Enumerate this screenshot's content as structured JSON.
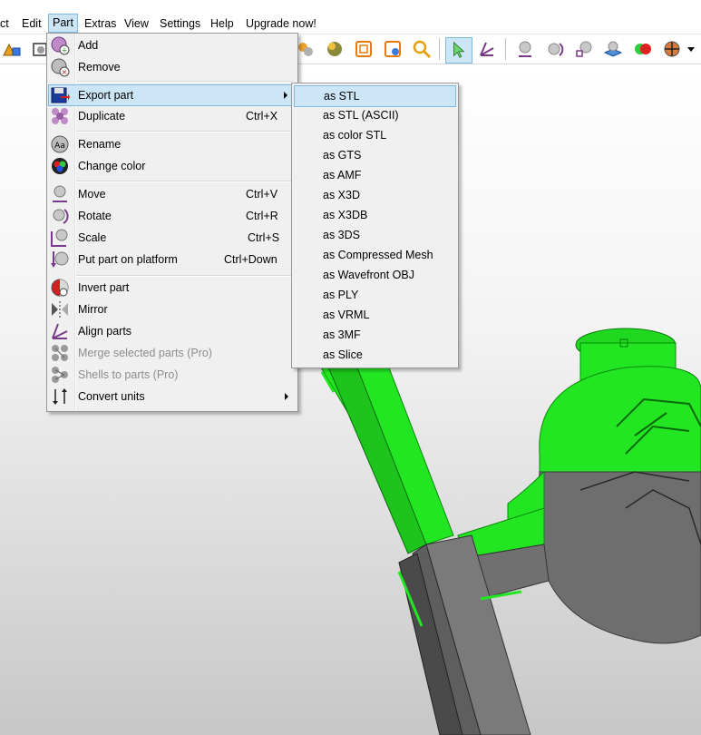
{
  "menubar": {
    "items": [
      "ct",
      "Edit",
      "Part",
      "Extras",
      "View",
      "Settings",
      "Help",
      "Upgrade now!"
    ],
    "active": "Part"
  },
  "toolbar": {
    "icons": [
      "primitives-icon",
      "view-box-icon",
      "spheres-icon",
      "sphere-color-icon",
      "wireframe-box-icon",
      "box-settings-icon",
      "magnifier-icon",
      "select-cursor-icon",
      "align-arrows-icon",
      "move-sphere-icon",
      "rotate-sphere-icon",
      "scale-sphere-icon",
      "platform-icon",
      "color-spheres-icon",
      "mirror-sphere-icon",
      "dropdown-arrow-icon"
    ]
  },
  "part_menu": {
    "items": [
      {
        "label": "Add",
        "icon": "add-part-icon",
        "shortcut": "",
        "disabled": false
      },
      {
        "label": "Remove",
        "icon": "remove-part-icon",
        "shortcut": "",
        "disabled": false
      },
      {
        "label": "Export part",
        "icon": "export-floppy-icon",
        "shortcut": "",
        "disabled": false,
        "submenu": true,
        "highlighted": true
      },
      {
        "label": "Duplicate",
        "icon": "duplicate-spheres-icon",
        "shortcut": "Ctrl+X",
        "disabled": false
      },
      {
        "label": "Rename",
        "icon": "rename-icon",
        "shortcut": "",
        "disabled": false
      },
      {
        "label": "Change color",
        "icon": "change-color-icon",
        "shortcut": "",
        "disabled": false
      },
      {
        "label": "Move",
        "icon": "move-icon",
        "shortcut": "Ctrl+V",
        "disabled": false
      },
      {
        "label": "Rotate",
        "icon": "rotate-icon",
        "shortcut": "Ctrl+R",
        "disabled": false
      },
      {
        "label": "Scale",
        "icon": "scale-icon",
        "shortcut": "Ctrl+S",
        "disabled": false
      },
      {
        "label": "Put part on platform",
        "icon": "platform-icon",
        "shortcut": "Ctrl+Down",
        "disabled": false
      },
      {
        "label": "Invert part",
        "icon": "invert-part-icon",
        "shortcut": "",
        "disabled": false
      },
      {
        "label": "Mirror",
        "icon": "mirror-icon",
        "shortcut": "",
        "disabled": false
      },
      {
        "label": "Align parts",
        "icon": "align-parts-icon",
        "shortcut": "",
        "disabled": false
      },
      {
        "label": "Merge selected parts (Pro)",
        "icon": "merge-parts-icon",
        "shortcut": "",
        "disabled": true
      },
      {
        "label": "Shells to parts (Pro)",
        "icon": "shells-to-parts-icon",
        "shortcut": "",
        "disabled": true
      },
      {
        "label": "Convert units",
        "icon": "convert-units-icon",
        "shortcut": "",
        "disabled": false,
        "submenu": true
      }
    ]
  },
  "export_submenu": {
    "items": [
      "as STL",
      "as STL (ASCII)",
      "as color STL",
      "as GTS",
      "as AMF",
      "as X3D",
      "as X3DB",
      "as 3DS",
      "as Compressed Mesh",
      "as Wavefront OBJ",
      "as PLY",
      "as VRML",
      "as 3MF",
      "as Slice"
    ],
    "highlighted": "as STL"
  },
  "colors": {
    "menu_bg": "#f0f0f0",
    "highlight": "#cde6f7",
    "highlight_border": "#7fb8e0",
    "model_green": "#22e622",
    "model_gray": "#6b6b6b"
  }
}
